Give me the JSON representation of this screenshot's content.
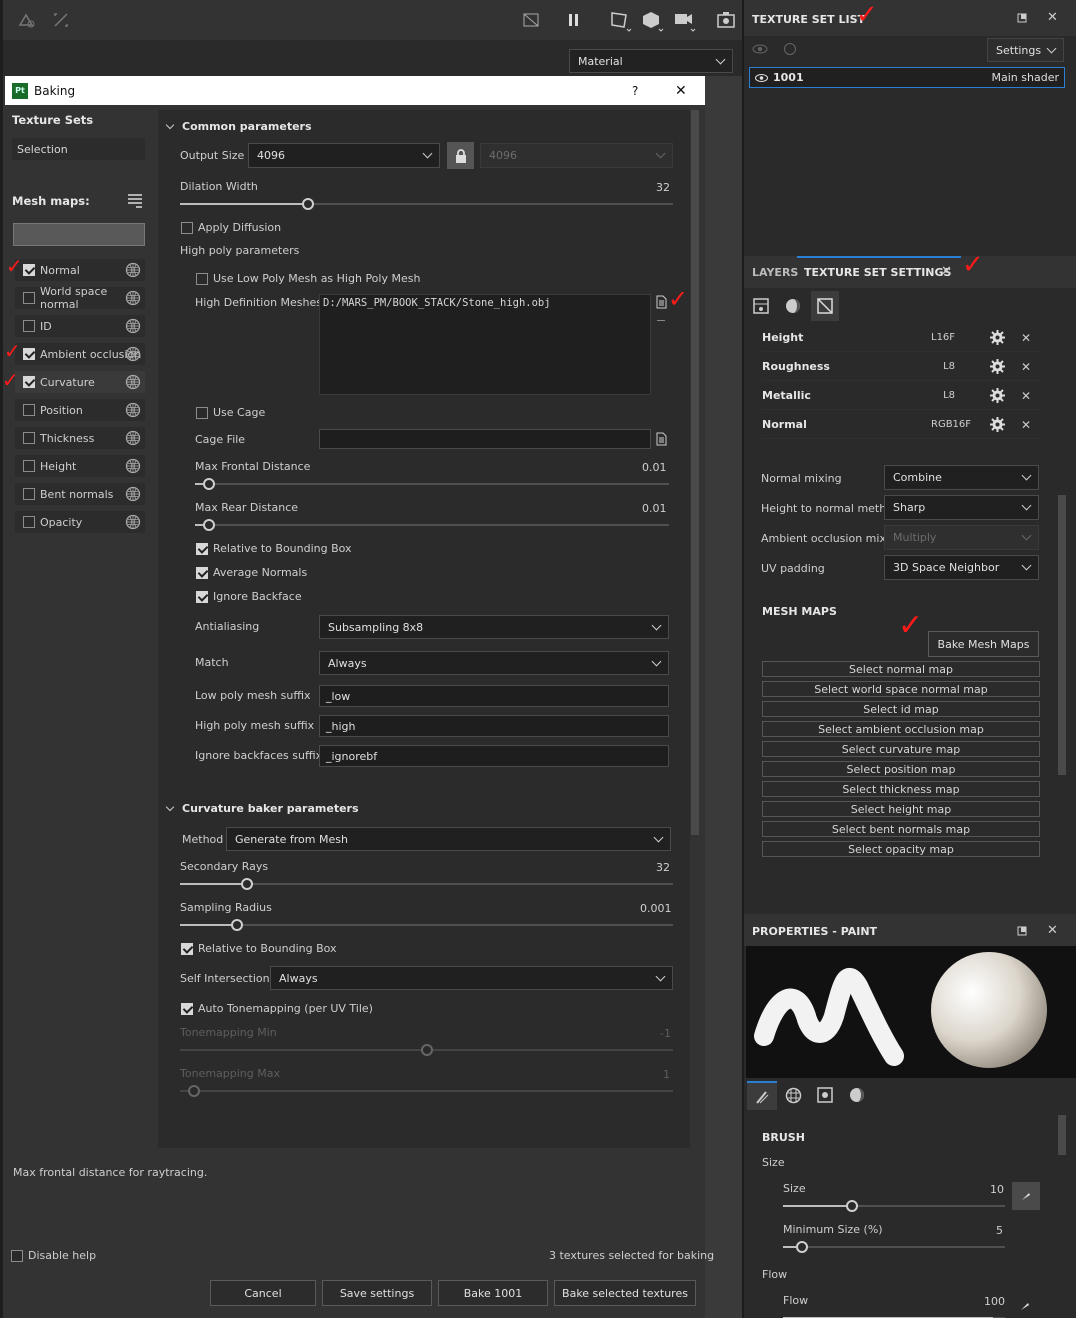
{
  "toolbar": {
    "material_select": "Material"
  },
  "dialog": {
    "title": "Baking",
    "help": "?",
    "close": "✕",
    "texture_sets_label": "Texture Sets",
    "selection": "Selection",
    "mesh_maps_label": "Mesh maps:",
    "common": {
      "title": "Common parameters",
      "output_size_label": "Output Size",
      "output_size": "4096",
      "output_size_locked": "4096",
      "dilation_label": "Dilation Width",
      "dilation": "32",
      "apply_diffusion": "Apply Diffusion",
      "high_poly_params": "High poly parameters",
      "use_low_poly": "Use Low Poly Mesh as High Poly Mesh",
      "hd_meshes_label": "High Definition Meshes",
      "hd_mesh_path": "D:/MARS_PM/BOOK_STACK/Stone_high.obj",
      "use_cage": "Use Cage",
      "cage_file": "Cage File",
      "max_frontal_label": "Max Frontal Distance",
      "max_frontal": "0.01",
      "max_rear_label": "Max Rear Distance",
      "max_rear": "0.01",
      "relative_bbox": "Relative to Bounding Box",
      "average_normals": "Average Normals",
      "ignore_backface": "Ignore Backface",
      "antialiasing_label": "Antialiasing",
      "antialiasing": "Subsampling 8x8",
      "match_label": "Match",
      "match": "Always",
      "low_suffix_label": "Low poly mesh suffix",
      "low_suffix": "_low",
      "high_suffix_label": "High poly mesh suffix",
      "high_suffix": "_high",
      "ignore_suffix_label": "Ignore backfaces suffix",
      "ignore_suffix": "_ignorebf"
    },
    "maps": [
      {
        "label": "Normal",
        "checked": true
      },
      {
        "label": "World space normal",
        "checked": false
      },
      {
        "label": "ID",
        "checked": false
      },
      {
        "label": "Ambient occlusion",
        "checked": true
      },
      {
        "label": "Curvature",
        "checked": true
      },
      {
        "label": "Position",
        "checked": false
      },
      {
        "label": "Thickness",
        "checked": false
      },
      {
        "label": "Height",
        "checked": false
      },
      {
        "label": "Bent normals",
        "checked": false
      },
      {
        "label": "Opacity",
        "checked": false
      }
    ],
    "curv": {
      "title": "Curvature baker parameters",
      "method_label": "Method",
      "method": "Generate from Mesh",
      "rays_label": "Secondary Rays",
      "rays": "32",
      "radius_label": "Sampling Radius",
      "radius": "0.001",
      "relative_bbox": "Relative to Bounding Box",
      "self_int_label": "Self Intersection",
      "self_int": "Always",
      "auto_tone": "Auto Tonemapping (per UV Tile)",
      "tone_min_label": "Tonemapping Min",
      "tone_min": "-1",
      "tone_max_label": "Tonemapping Max",
      "tone_max": "1"
    },
    "help_text": "Max frontal distance for raytracing.",
    "disable_help": "Disable help",
    "status": "3 textures selected for baking",
    "buttons": {
      "cancel": "Cancel",
      "save": "Save settings",
      "bake_one": "Bake 1001",
      "bake_sel": "Bake selected textures"
    }
  },
  "tsl": {
    "title": "TEXTURE SET LIST",
    "settings": "Settings",
    "set_name": "1001",
    "shader": "Main shader"
  },
  "tss": {
    "tab_layers": "LAYERS",
    "tab_settings": "TEXTURE SET SETTINGS",
    "channels": [
      {
        "name": "Height",
        "fmt": "L16F"
      },
      {
        "name": "Roughness",
        "fmt": "L8"
      },
      {
        "name": "Metallic",
        "fmt": "L8"
      },
      {
        "name": "Normal",
        "fmt": "RGB16F"
      }
    ],
    "normal_mixing_label": "Normal mixing",
    "normal_mixing": "Combine",
    "htn_label": "Height to normal method",
    "htn": "Sharp",
    "ao_mix_label": "Ambient occlusion mixing",
    "ao_mix": "Multiply",
    "uv_pad_label": "UV padding",
    "uv_pad": "3D Space Neighbor",
    "mesh_maps_title": "MESH MAPS",
    "bake_btn": "Bake Mesh Maps",
    "select_maps": [
      "Select normal map",
      "Select world space normal map",
      "Select id map",
      "Select ambient occlusion map",
      "Select curvature map",
      "Select position map",
      "Select thickness map",
      "Select height map",
      "Select bent normals map",
      "Select opacity map"
    ]
  },
  "props": {
    "title": "PROPERTIES - PAINT",
    "brush": "BRUSH",
    "size_group": "Size",
    "size_label": "Size",
    "size": "10",
    "min_size_label": "Minimum Size (%)",
    "min_size": "5",
    "flow_group": "Flow",
    "flow_label": "Flow",
    "flow": "100"
  },
  "colors": {
    "bg": "#333333",
    "panel": "#2b2b2b",
    "accent": "#2a7fd4"
  }
}
